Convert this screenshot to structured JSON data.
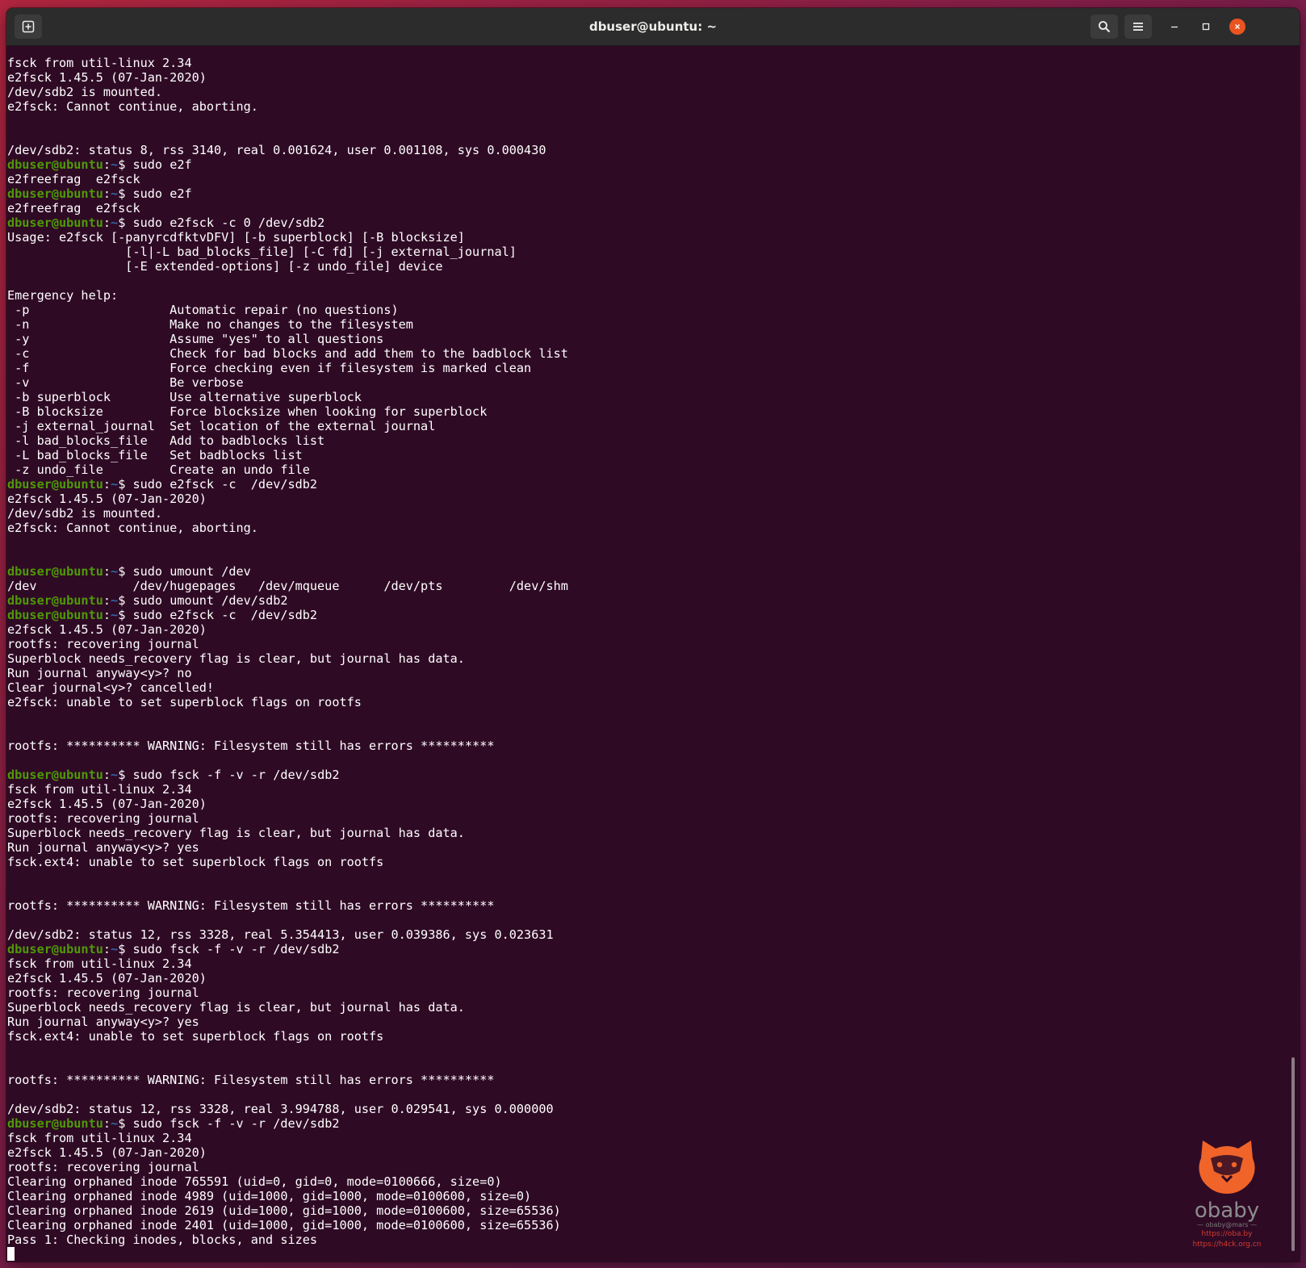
{
  "window": {
    "title": "dbuser@ubuntu: ~"
  },
  "icons": {
    "new_tab": "new-tab-icon",
    "search": "search-icon",
    "menu": "hamburger-menu-icon",
    "minimize": "minimize-icon",
    "maximize": "maximize-icon",
    "close": "close-icon"
  },
  "colors": {
    "terminal_bg": "#2f0a25",
    "prompt_user": "#4e9a06",
    "prompt_path": "#3465a4",
    "close_button": "#e95420"
  },
  "prompt": {
    "user": "dbuser@ubuntu",
    "sep": ":",
    "path": "~",
    "sym": "$ "
  },
  "terminal_lines": [
    {
      "t": "fsck from util-linux 2.34"
    },
    {
      "t": "e2fsck 1.45.5 (07-Jan-2020)"
    },
    {
      "t": "/dev/sdb2 is mounted."
    },
    {
      "t": "e2fsck: Cannot continue, aborting."
    },
    {
      "t": ""
    },
    {
      "t": ""
    },
    {
      "t": "/dev/sdb2: status 8, rss 3140, real 0.001624, user 0.001108, sys 0.000430"
    },
    {
      "p": true,
      "t": "sudo e2f"
    },
    {
      "t": "e2freefrag  e2fsck"
    },
    {
      "p": true,
      "t": "sudo e2f"
    },
    {
      "t": "e2freefrag  e2fsck"
    },
    {
      "p": true,
      "t": "sudo e2fsck -c 0 /dev/sdb2"
    },
    {
      "t": "Usage: e2fsck [-panyrcdfktvDFV] [-b superblock] [-B blocksize]"
    },
    {
      "t": "                [-l|-L bad_blocks_file] [-C fd] [-j external_journal]"
    },
    {
      "t": "                [-E extended-options] [-z undo_file] device"
    },
    {
      "t": ""
    },
    {
      "t": "Emergency help:"
    },
    {
      "t": " -p                   Automatic repair (no questions)"
    },
    {
      "t": " -n                   Make no changes to the filesystem"
    },
    {
      "t": " -y                   Assume \"yes\" to all questions"
    },
    {
      "t": " -c                   Check for bad blocks and add them to the badblock list"
    },
    {
      "t": " -f                   Force checking even if filesystem is marked clean"
    },
    {
      "t": " -v                   Be verbose"
    },
    {
      "t": " -b superblock        Use alternative superblock"
    },
    {
      "t": " -B blocksize         Force blocksize when looking for superblock"
    },
    {
      "t": " -j external_journal  Set location of the external journal"
    },
    {
      "t": " -l bad_blocks_file   Add to badblocks list"
    },
    {
      "t": " -L bad_blocks_file   Set badblocks list"
    },
    {
      "t": " -z undo_file         Create an undo file"
    },
    {
      "p": true,
      "t": "sudo e2fsck -c  /dev/sdb2"
    },
    {
      "t": "e2fsck 1.45.5 (07-Jan-2020)"
    },
    {
      "t": "/dev/sdb2 is mounted."
    },
    {
      "t": "e2fsck: Cannot continue, aborting."
    },
    {
      "t": ""
    },
    {
      "t": ""
    },
    {
      "p": true,
      "t": "sudo umount /dev"
    },
    {
      "t": "/dev             /dev/hugepages   /dev/mqueue      /dev/pts         /dev/shm"
    },
    {
      "p": true,
      "t": "sudo umount /dev/sdb2"
    },
    {
      "p": true,
      "t": "sudo e2fsck -c  /dev/sdb2"
    },
    {
      "t": "e2fsck 1.45.5 (07-Jan-2020)"
    },
    {
      "t": "rootfs: recovering journal"
    },
    {
      "t": "Superblock needs_recovery flag is clear, but journal has data."
    },
    {
      "t": "Run journal anyway<y>? no"
    },
    {
      "t": "Clear journal<y>? cancelled!"
    },
    {
      "t": "e2fsck: unable to set superblock flags on rootfs"
    },
    {
      "t": ""
    },
    {
      "t": ""
    },
    {
      "t": "rootfs: ********** WARNING: Filesystem still has errors **********"
    },
    {
      "t": ""
    },
    {
      "p": true,
      "t": "sudo fsck -f -v -r /dev/sdb2"
    },
    {
      "t": "fsck from util-linux 2.34"
    },
    {
      "t": "e2fsck 1.45.5 (07-Jan-2020)"
    },
    {
      "t": "rootfs: recovering journal"
    },
    {
      "t": "Superblock needs_recovery flag is clear, but journal has data."
    },
    {
      "t": "Run journal anyway<y>? yes"
    },
    {
      "t": "fsck.ext4: unable to set superblock flags on rootfs"
    },
    {
      "t": ""
    },
    {
      "t": ""
    },
    {
      "t": "rootfs: ********** WARNING: Filesystem still has errors **********"
    },
    {
      "t": ""
    },
    {
      "t": "/dev/sdb2: status 12, rss 3328, real 5.354413, user 0.039386, sys 0.023631"
    },
    {
      "p": true,
      "t": "sudo fsck -f -v -r /dev/sdb2"
    },
    {
      "t": "fsck from util-linux 2.34"
    },
    {
      "t": "e2fsck 1.45.5 (07-Jan-2020)"
    },
    {
      "t": "rootfs: recovering journal"
    },
    {
      "t": "Superblock needs_recovery flag is clear, but journal has data."
    },
    {
      "t": "Run journal anyway<y>? yes"
    },
    {
      "t": "fsck.ext4: unable to set superblock flags on rootfs"
    },
    {
      "t": ""
    },
    {
      "t": ""
    },
    {
      "t": "rootfs: ********** WARNING: Filesystem still has errors **********"
    },
    {
      "t": ""
    },
    {
      "t": "/dev/sdb2: status 12, rss 3328, real 3.994788, user 0.029541, sys 0.000000"
    },
    {
      "p": true,
      "t": "sudo fsck -f -v -r /dev/sdb2"
    },
    {
      "t": "fsck from util-linux 2.34"
    },
    {
      "t": "e2fsck 1.45.5 (07-Jan-2020)"
    },
    {
      "t": "rootfs: recovering journal"
    },
    {
      "t": "Clearing orphaned inode 765591 (uid=0, gid=0, mode=0100666, size=0)"
    },
    {
      "t": "Clearing orphaned inode 4989 (uid=1000, gid=1000, mode=0100600, size=0)"
    },
    {
      "t": "Clearing orphaned inode 2619 (uid=1000, gid=1000, mode=0100600, size=65536)"
    },
    {
      "t": "Clearing orphaned inode 2401 (uid=1000, gid=1000, mode=0100600, size=65536)"
    },
    {
      "t": "Pass 1: Checking inodes, blocks, and sizes"
    },
    {
      "cursor": true,
      "t": ""
    }
  ],
  "watermark": {
    "brand": "obaby",
    "sub": "— obaby@mars —",
    "link1": "https://oba.by",
    "link2": "https://h4ck.org.cn"
  }
}
